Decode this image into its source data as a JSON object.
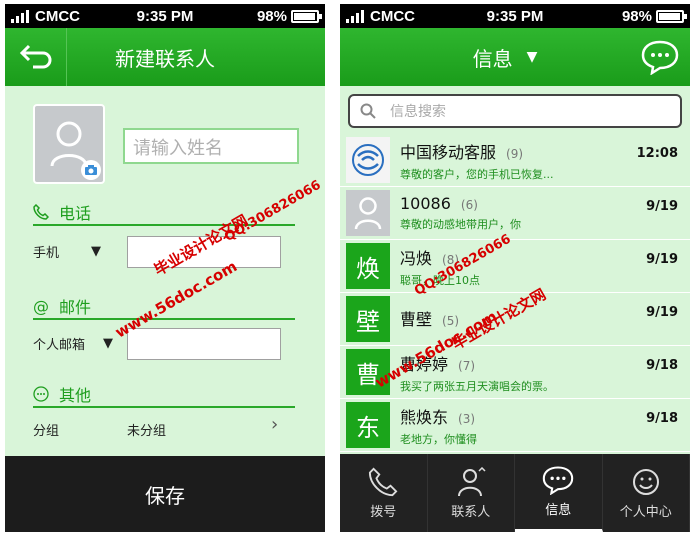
{
  "status": {
    "carrier": "CMCC",
    "time": "9:35 PM",
    "battery": "98%",
    "battery_level": 0.98
  },
  "new_contact": {
    "title": "新建联系人",
    "name_placeholder": "请输入姓名",
    "phone_section": "电话",
    "phone_type": "手机",
    "email_section": "邮件",
    "email_type": "个人邮箱",
    "other_section": "其他",
    "group_label": "分组",
    "group_value": "未分组",
    "save_label": "保存",
    "dropdown_glyph": "▼",
    "arrow_glyph": "›"
  },
  "messages": {
    "title": "信息",
    "title_arrow": "▼",
    "search_placeholder": "信息搜索",
    "items": [
      {
        "name": "中国移动客服",
        "count": "(9)",
        "preview": "尊敬的客户，您的手机已恢复...",
        "date": "12:08",
        "avatar": "",
        "avatar_icon": "cmcc-logo-icon"
      },
      {
        "name": "10086",
        "count": "(6)",
        "preview": "尊敬的动感地带用户，你",
        "date": "9/19",
        "avatar": "",
        "avatar_icon": "person-icon"
      },
      {
        "name": "冯焕",
        "count": "(8)",
        "preview": "聪哥，晚上10点",
        "date": "9/19",
        "avatar": "焕",
        "avatar_icon": ""
      },
      {
        "name": "曹壁",
        "count": "(5)",
        "preview": "",
        "date": "9/19",
        "avatar": "壁",
        "avatar_icon": ""
      },
      {
        "name": "曹婷婷",
        "count": "(7)",
        "preview": "我买了两张五月天演唱会的票。",
        "date": "9/18",
        "avatar": "曹",
        "avatar_icon": ""
      },
      {
        "name": "熊焕东",
        "count": "(3)",
        "preview": "老地方，你懂得",
        "date": "9/18",
        "avatar": "东",
        "avatar_icon": ""
      }
    ],
    "tabs": [
      {
        "label": "拨号",
        "icon": "phone-icon"
      },
      {
        "label": "联系人",
        "icon": "contacts-icon"
      },
      {
        "label": "信息",
        "icon": "chat-icon",
        "active": true
      },
      {
        "label": "个人中心",
        "icon": "smiley-icon"
      }
    ]
  },
  "watermarks": {
    "site": "www.56doc.com",
    "qq": "QQ:306826066",
    "name": "毕业设计论文网"
  },
  "colors": {
    "green": "#1a9c1a",
    "panel": "#d9f5d9",
    "dark": "#1c1c1c",
    "watermark": "#d60000"
  }
}
